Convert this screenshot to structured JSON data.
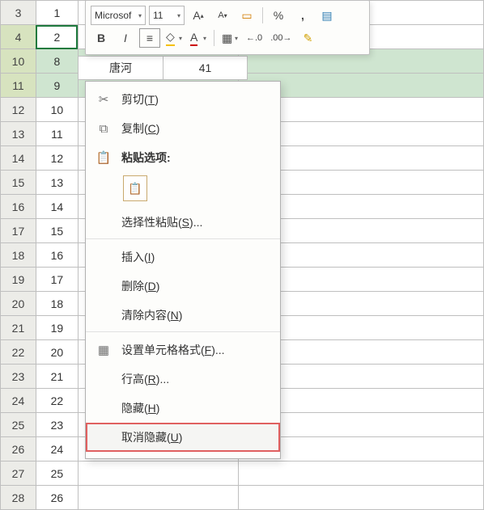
{
  "rows": [
    {
      "hdr": "3",
      "a": "1"
    },
    {
      "hdr": "4",
      "a": "2",
      "sel": true,
      "anchor": true
    },
    {
      "hdr": "10",
      "a": "8",
      "sel": true
    },
    {
      "hdr": "11",
      "a": "9",
      "sel": true
    },
    {
      "hdr": "12",
      "a": "10"
    },
    {
      "hdr": "13",
      "a": "11"
    },
    {
      "hdr": "14",
      "a": "12"
    },
    {
      "hdr": "15",
      "a": "13"
    },
    {
      "hdr": "16",
      "a": "14"
    },
    {
      "hdr": "17",
      "a": "15"
    },
    {
      "hdr": "18",
      "a": "16"
    },
    {
      "hdr": "19",
      "a": "17"
    },
    {
      "hdr": "20",
      "a": "18"
    },
    {
      "hdr": "21",
      "a": "19"
    },
    {
      "hdr": "22",
      "a": "20"
    },
    {
      "hdr": "23",
      "a": "21"
    },
    {
      "hdr": "24",
      "a": "22"
    },
    {
      "hdr": "25",
      "a": "23"
    },
    {
      "hdr": "26",
      "a": "24"
    },
    {
      "hdr": "27",
      "a": "25"
    },
    {
      "hdr": "28",
      "a": "26"
    }
  ],
  "overlay_row": {
    "b": "唐河",
    "c": "41"
  },
  "mini_toolbar": {
    "font_name": "Microsof",
    "font_size": "11",
    "inc_font": "A",
    "dec_font": "A",
    "accounting": "%",
    "comma": ",",
    "bold": "B",
    "italic": "I",
    "align_center": "≡",
    "fill_glyph": "◇",
    "font_color_glyph": "A",
    "border_glyph": "▦",
    "inc_dec": ".0",
    "dec_dec": ".00",
    "format_painter": "✎"
  },
  "menu": {
    "cut": {
      "label": "剪切",
      "mn": "T"
    },
    "copy": {
      "label": "复制",
      "mn": "C"
    },
    "paste_opts_title": "粘贴选项:",
    "paste_special": {
      "label": "选择性粘贴",
      "mn": "S",
      "suffix": "..."
    },
    "insert": {
      "label": "插入",
      "mn": "I"
    },
    "delete": {
      "label": "删除",
      "mn": "D"
    },
    "clear": {
      "label": "清除内容",
      "mn": "N"
    },
    "format_cells": {
      "label": "设置单元格格式",
      "mn": "F",
      "suffix": "..."
    },
    "row_height": {
      "label": "行高",
      "mn": "R",
      "suffix": "..."
    },
    "hide": {
      "label": "隐藏",
      "mn": "H"
    },
    "unhide": {
      "label": "取消隐藏",
      "mn": "U"
    }
  }
}
